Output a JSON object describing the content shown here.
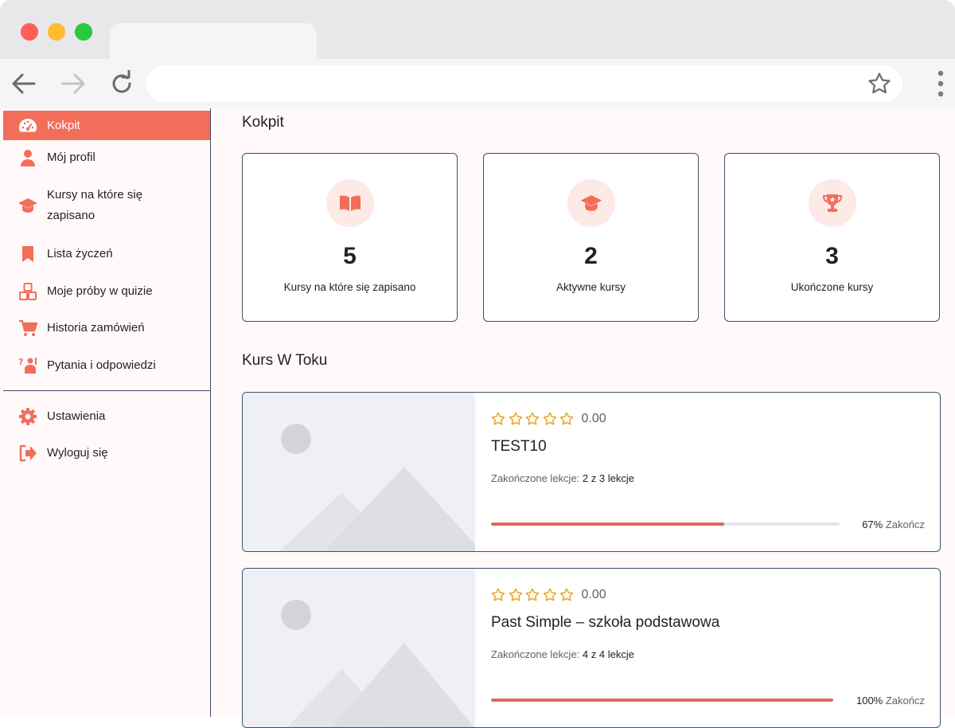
{
  "sidebar": {
    "items": [
      {
        "label": "Kokpit",
        "icon": "dashboard-icon"
      },
      {
        "label": "Mój profil",
        "icon": "user-icon"
      },
      {
        "label": "Kursy na które się",
        "label2": "zapisano",
        "icon": "graduation-cap-icon"
      },
      {
        "label": "Lista życzeń",
        "icon": "bookmark-icon"
      },
      {
        "label": "Moje próby w quizie",
        "icon": "quiz-blocks-icon"
      },
      {
        "label": "Historia zamówień",
        "icon": "cart-icon"
      },
      {
        "label": "Pytania i odpowiedzi",
        "icon": "question-answer-icon"
      }
    ],
    "bottom_items": [
      {
        "label": "Ustawienia",
        "icon": "gear-icon"
      },
      {
        "label": "Wyloguj się",
        "icon": "logout-icon"
      }
    ]
  },
  "main": {
    "title": "Kokpit",
    "stats": [
      {
        "value": "5",
        "label": "Kursy na które się zapisano",
        "icon": "book-icon"
      },
      {
        "value": "2",
        "label": "Aktywne kursy",
        "icon": "graduation-cap-icon"
      },
      {
        "value": "3",
        "label": "Ukończone kursy",
        "icon": "trophy-icon"
      }
    ],
    "in_progress_title": "Kurs W Toku",
    "courses": [
      {
        "rating": "0.00",
        "title": "TEST10",
        "lessons_label": "Zakończone lekcje:",
        "lessons_value": "2 z 3 lekcje",
        "progress": 67,
        "progress_text": "67%",
        "finish_label": "Zakończ"
      },
      {
        "rating": "0.00",
        "title": "Past Simple – szkoła podstawowa",
        "lessons_label": "Zakończone lekcje:",
        "lessons_value": "4 z 4 lekcje",
        "progress": 100,
        "progress_text": "100%",
        "finish_label": "Zakończ"
      }
    ]
  },
  "colors": {
    "accent": "#f26e5b",
    "star": "#e8a21a",
    "border": "#3f4e6a"
  }
}
